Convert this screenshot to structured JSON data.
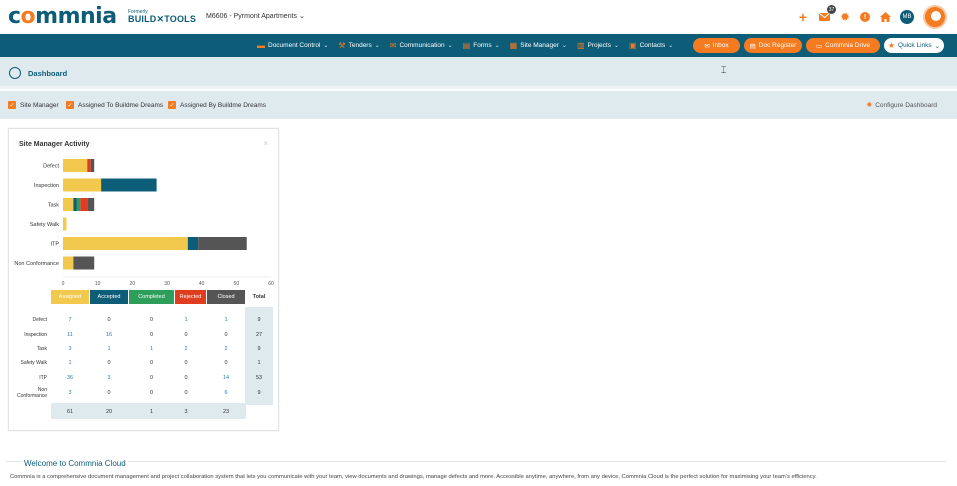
{
  "header": {
    "logo_prefix": "c",
    "logo_o": "o",
    "logo_rest": "mmnia",
    "formerly": "Formerly",
    "build_tools": "BUILD✕TOOLS",
    "project": "M6606 - Pyrmont Apartments",
    "project_chevron": "⌄",
    "mail_badge": "37",
    "user_initials": "MB"
  },
  "icons": {
    "add": "plus-icon",
    "mail": "mail-icon",
    "settings": "gear-icon",
    "alert": "alert-icon",
    "home": "home-icon"
  },
  "nav": {
    "items": [
      {
        "label": "Document Control",
        "icon": "folder-icon"
      },
      {
        "label": "Tenders",
        "icon": "hammer-icon"
      },
      {
        "label": "Communication",
        "icon": "envelope-icon"
      },
      {
        "label": "Forms",
        "icon": "forms-icon"
      },
      {
        "label": "Site Manager",
        "icon": "clipboard-icon"
      },
      {
        "label": "Projects",
        "icon": "projects-icon"
      },
      {
        "label": "Contacts",
        "icon": "contacts-icon"
      }
    ],
    "inbox": "Inbox",
    "doc_register": "Doc Register",
    "commnia_drive": "Commnia Drive",
    "quick_links": "Quick Links"
  },
  "dashboard": {
    "title": "Dashboard"
  },
  "filters": {
    "site_manager": "Site Manager",
    "assigned_to": "Assigned To Buildme Dreams",
    "assigned_by": "Assigned By Buildme Dreams",
    "configure": "Configure Dashboard"
  },
  "widget": {
    "title": "Site Manager Activity",
    "close": "×",
    "columns": [
      "Assigned",
      "Accepted",
      "Completed",
      "Rejected",
      "Closed",
      "Total"
    ],
    "column_colors": [
      "#f2c94c",
      "#0d5c78",
      "#2e9e5b",
      "#e03c1f",
      "#555555"
    ],
    "rows": [
      {
        "label": "Defect",
        "values": [
          "7",
          "0",
          "0",
          "1",
          "1"
        ],
        "total": "9"
      },
      {
        "label": "Inspection",
        "values": [
          "11",
          "16",
          "0",
          "0",
          "0"
        ],
        "total": "27"
      },
      {
        "label": "Task",
        "values": [
          "3",
          "1",
          "1",
          "2",
          "2"
        ],
        "total": "9"
      },
      {
        "label": "Safety Walk",
        "values": [
          "1",
          "0",
          "0",
          "0",
          "0"
        ],
        "total": "1"
      },
      {
        "label": "ITP",
        "values": [
          "36",
          "3",
          "0",
          "0",
          "14"
        ],
        "total": "53"
      },
      {
        "label": "Non Conformance",
        "values": [
          "3",
          "0",
          "0",
          "0",
          "6"
        ],
        "total": "9"
      }
    ],
    "sums": [
      "61",
      "20",
      "1",
      "3",
      "23"
    ]
  },
  "chart_data": {
    "type": "bar",
    "orientation": "horizontal",
    "stacked": true,
    "categories": [
      "Defect",
      "Inspection",
      "Task",
      "Safety Walk",
      "ITP",
      "Non Conformance"
    ],
    "series": [
      {
        "values": [
          7,
          11,
          3,
          1,
          36,
          3
        ],
        "color": "#f2c94c"
      },
      {
        "values": [
          0,
          16,
          1,
          0,
          3,
          0
        ],
        "color": "#0d5c78"
      },
      {
        "values": [
          0,
          0,
          1,
          0,
          0,
          0
        ],
        "color": "#2e9e5b"
      },
      {
        "values": [
          1,
          0,
          2,
          0,
          0,
          0
        ],
        "color": "#e03c1f"
      },
      {
        "values": [
          1,
          0,
          2,
          0,
          14,
          6
        ],
        "color": "#555555"
      }
    ],
    "xticks": [
      "0",
      "10",
      "20",
      "30",
      "40",
      "50",
      "60"
    ],
    "xlim": [
      0,
      60
    ],
    "grid": false
  },
  "welcome": {
    "title": "Welcome to Commnia Cloud",
    "text": "Commnia is a comprehensive document management and project collaboration system that lets you communicate with your team, view documents and drawings, manage defects and more. Accessible anytime, anywhere, from any device, Commnia Cloud is the perfect solution for maximising your team's efficiency."
  }
}
